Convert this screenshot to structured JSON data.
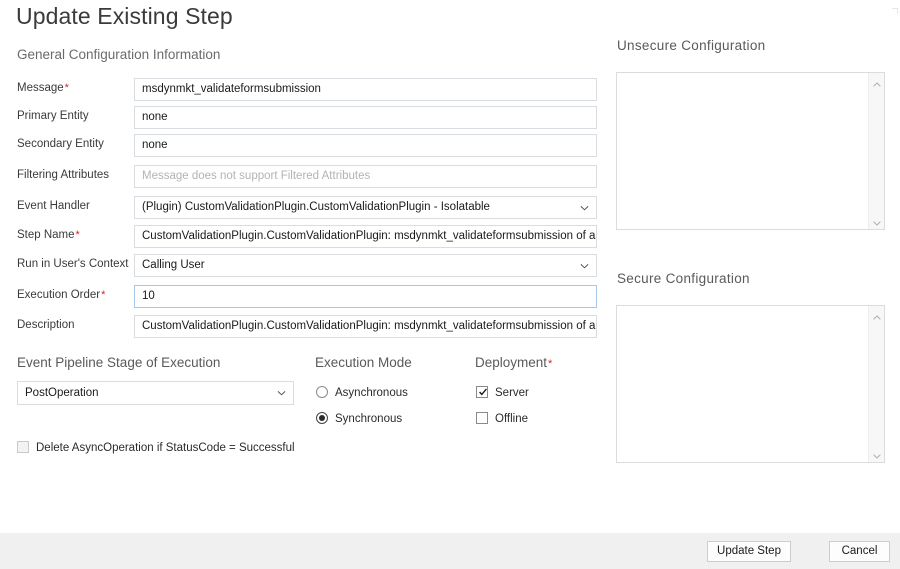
{
  "dialog": {
    "title": "Update Existing Step",
    "section_subtitle": "General Configuration Information"
  },
  "fields": [
    {
      "label": "Message",
      "required": true,
      "value": "msdynmkt_validateformsubmission",
      "type": "text",
      "state": "normal",
      "placeholder": ""
    },
    {
      "label": "Primary Entity",
      "required": false,
      "value": "none",
      "type": "text",
      "state": "normal",
      "placeholder": ""
    },
    {
      "label": "Secondary Entity",
      "required": false,
      "value": "none",
      "type": "text",
      "state": "normal",
      "placeholder": ""
    },
    {
      "label": "Filtering Attributes",
      "required": false,
      "value": "",
      "type": "text",
      "state": "placeholder",
      "placeholder": "Message does not support Filtered Attributes"
    },
    {
      "label": "Event Handler",
      "required": false,
      "value": "(Plugin) CustomValidationPlugin.CustomValidationPlugin - Isolatable",
      "type": "select",
      "state": "normal",
      "placeholder": ""
    },
    {
      "label": "Step Name",
      "required": true,
      "value": "CustomValidationPlugin.CustomValidationPlugin: msdynmkt_validateformsubmission of any Ent",
      "type": "text",
      "state": "normal",
      "placeholder": ""
    },
    {
      "label": "Run in User's Context",
      "required": false,
      "value": "Calling User",
      "type": "select",
      "state": "normal",
      "placeholder": ""
    },
    {
      "label": "Execution Order",
      "required": true,
      "value": "10",
      "type": "text",
      "state": "focused",
      "placeholder": ""
    },
    {
      "label": "Description",
      "required": false,
      "value": "CustomValidationPlugin.CustomValidationPlugin: msdynmkt_validateformsubmission of any Ent",
      "type": "text",
      "state": "normal",
      "placeholder": ""
    }
  ],
  "pipeline": {
    "heading": "Event Pipeline Stage of Execution",
    "selected": "PostOperation"
  },
  "execution_mode": {
    "heading": "Execution Mode",
    "options": [
      {
        "label": "Asynchronous",
        "selected": false
      },
      {
        "label": "Synchronous",
        "selected": true
      }
    ]
  },
  "deployment": {
    "heading": "Deployment",
    "required": true,
    "options": [
      {
        "label": "Server",
        "checked": true
      },
      {
        "label": "Offline",
        "checked": false
      }
    ]
  },
  "delete_async": {
    "label": "Delete AsyncOperation if StatusCode = Successful",
    "checked": false,
    "disabled": true
  },
  "unsecure_configuration": {
    "heading": "Unsecure  Configuration",
    "value": ""
  },
  "secure_configuration": {
    "heading": "Secure  Configuration",
    "value": ""
  },
  "footer": {
    "update_label": "Update Step",
    "cancel_label": "Cancel"
  },
  "colors": {
    "required_asterisk": "#e01f1f",
    "focus_border": "#a8c8e8",
    "field_border": "#d9dde2",
    "footer_bg": "#f0f0f0",
    "heading_text": "#5a5a5a"
  }
}
